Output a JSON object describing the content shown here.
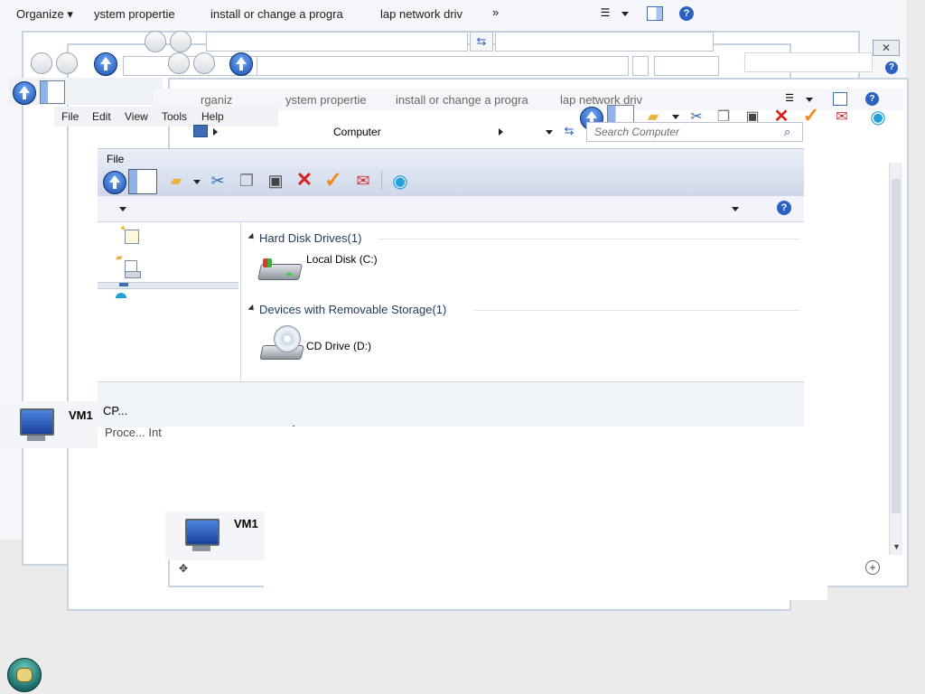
{
  "top_command_bar": {
    "items": [
      "Organizе ▾",
      "ystem propertie",
      "install or change a progra",
      "lap network driv",
      "»"
    ]
  },
  "ghost_command_bar": {
    "items": [
      "rganiz",
      "ystem propertie",
      "install or change a progra",
      "lap network driv"
    ]
  },
  "menu_bar": {
    "items": [
      "File",
      "Edit",
      "View",
      "Tools",
      "Help"
    ]
  },
  "explorer": {
    "address_text": "Computer",
    "search_placeholder": "Search Computer",
    "file_menu": "File",
    "groups": [
      {
        "title": "Hard Disk Drives(1)",
        "items": [
          {
            "label": "Local Disk (C:)"
          }
        ]
      },
      {
        "title": "Devices with Removable Storage(1)",
        "items": [
          {
            "label": "CD Drive (D:)"
          }
        ]
      }
    ],
    "details": {
      "line1": "CP...",
      "line2": "Proce... Int"
    }
  },
  "vm_labels": [
    "VM1",
    "VM1"
  ],
  "colors": {
    "toolbar_bg": "#dfe4f1",
    "accent_blue": "#1e395b",
    "desktop": "#ebebeb",
    "delete_red": "#d92121",
    "check_orange": "#f08a1c"
  },
  "icons": {
    "cursor": "resize-vertical-icon",
    "start_orb": "start-orb-icon"
  }
}
